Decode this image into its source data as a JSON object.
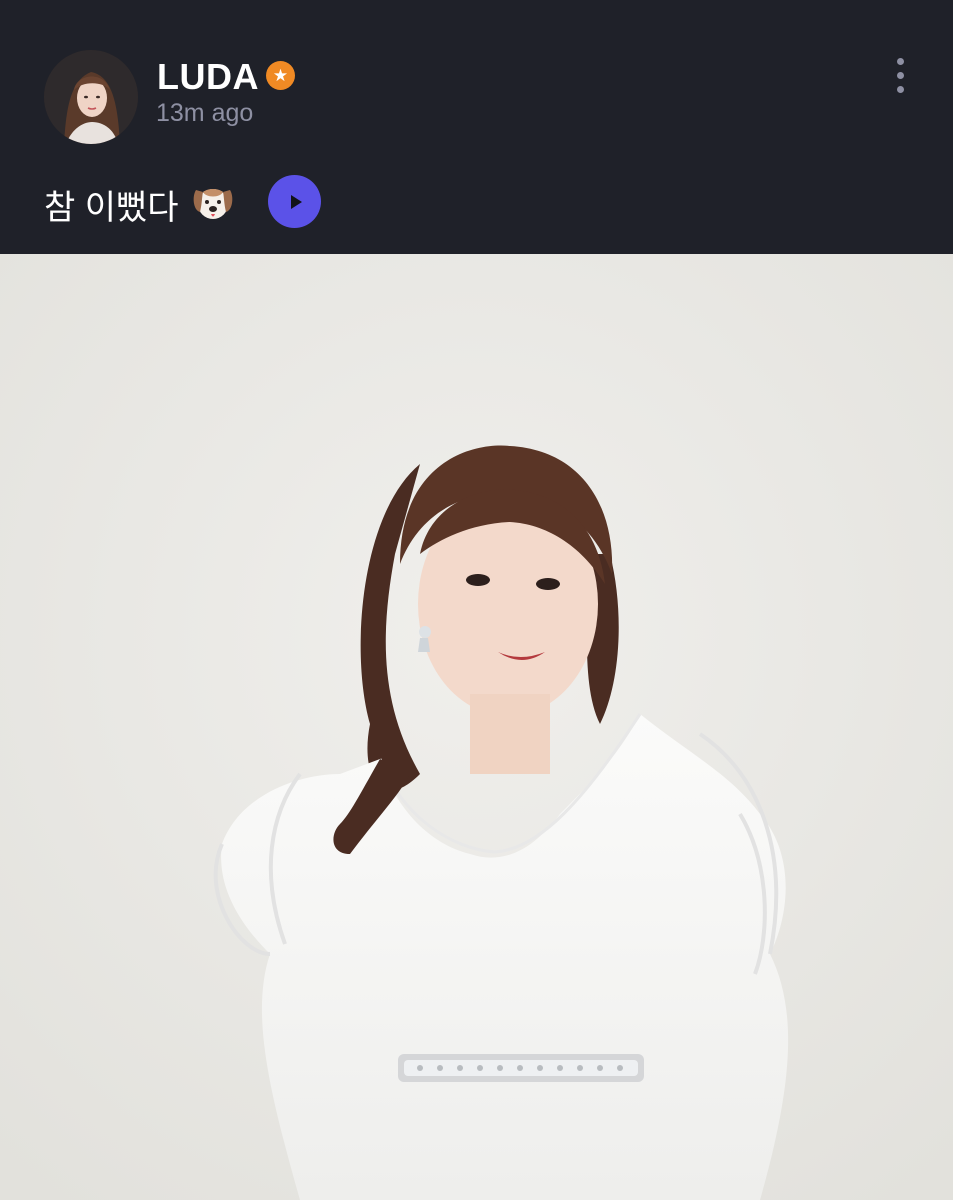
{
  "post": {
    "username": "LUDA",
    "timestamp": "13m ago",
    "caption": "참 이뻤다",
    "caption_emoji_icon": "dog-face-icon",
    "verified_icon": "star-badge-icon",
    "more_icon": "vertical-dots-icon",
    "play_icon": "play-icon"
  },
  "colors": {
    "background": "#1f2129",
    "verified_badge": "#f08a24",
    "play_button": "#5b52e8",
    "secondary_text": "#8e90a3"
  }
}
